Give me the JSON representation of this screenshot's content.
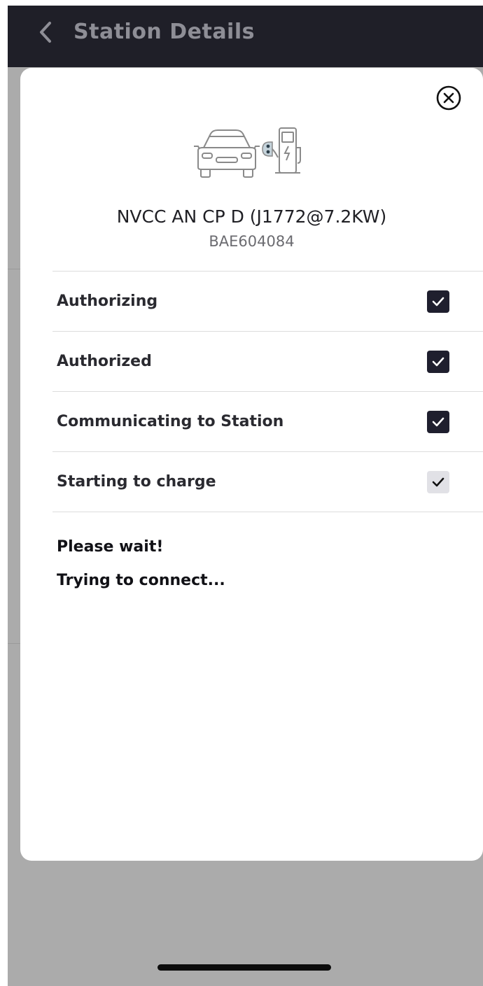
{
  "header": {
    "title": "Station Details",
    "back_icon": "chevron-left-icon"
  },
  "modal": {
    "close_icon": "close-circle-icon",
    "illustration_icon": "car-charging-station-icon",
    "station_name": "NVCC AN CP D (J1772@7.2KW)",
    "station_id": "BAE604084",
    "steps": [
      {
        "label": "Authorizing",
        "state": "done"
      },
      {
        "label": "Authorized",
        "state": "done"
      },
      {
        "label": "Communicating to Station",
        "state": "done"
      },
      {
        "label": "Starting to charge",
        "state": "pending"
      }
    ],
    "message_line1": "Please wait!",
    "message_line2": "Trying to connect..."
  },
  "colors": {
    "topbar": "#1f1f28",
    "check_done": "#1f1f2e",
    "check_pending": "#e1e1e6",
    "overlay": "#ababab"
  }
}
